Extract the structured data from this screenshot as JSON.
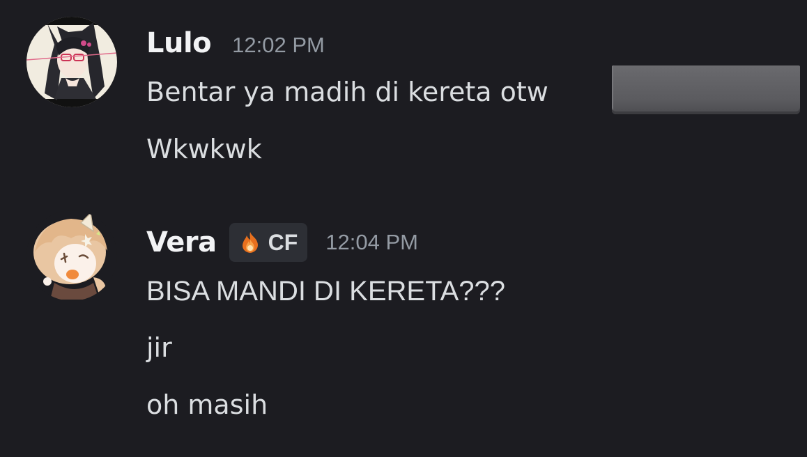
{
  "messages": [
    {
      "author": "Lulo",
      "timestamp": "12:02 PM",
      "lines": [
        "Bentar ya madih di kereta otw",
        "Wkwkwk"
      ]
    },
    {
      "author": "Vera",
      "role_badge": {
        "icon": "flame-icon",
        "label": "CF"
      },
      "timestamp": "12:04 PM",
      "lines": [
        "BISA MANDI DI KERETA???",
        "jir",
        "oh masih"
      ]
    }
  ],
  "colors": {
    "background": "#1c1c21",
    "username": "#f2f3f5",
    "message_text": "#dbdee1",
    "timestamp": "#949ba4",
    "badge_background": "#2d2f35",
    "redaction": "#5e5e62"
  }
}
